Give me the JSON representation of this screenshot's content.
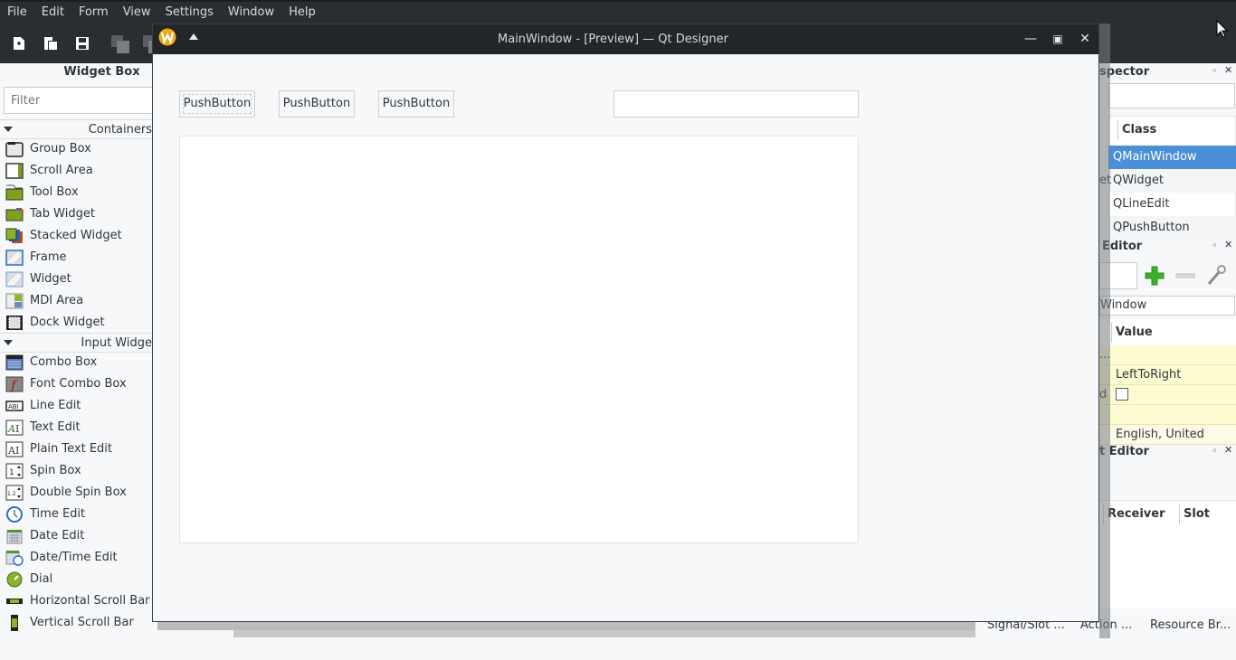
{
  "menubar": {
    "items": [
      "File",
      "Edit",
      "Form",
      "View",
      "Settings",
      "Window",
      "Help"
    ]
  },
  "toolbar": {
    "icons": [
      "new-form-icon",
      "open-form-icon",
      "save-form-icon",
      "cascade-windows-icon",
      "tile-windows-icon"
    ]
  },
  "widget_box": {
    "title": "Widget Box",
    "filter_placeholder": "Filter",
    "categories": [
      {
        "label": "Containers",
        "items": [
          "Group Box",
          "Scroll Area",
          "Tool Box",
          "Tab Widget",
          "Stacked Widget",
          "Frame",
          "Widget",
          "MDI Area",
          "Dock Widget"
        ]
      },
      {
        "label": "Input Widge",
        "items": [
          "Combo Box",
          "Font Combo Box",
          "Line Edit",
          "Text Edit",
          "Plain Text Edit",
          "Spin Box",
          "Double Spin Box",
          "Time Edit",
          "Date Edit",
          "Date/Time Edit",
          "Dial",
          "Horizontal Scroll Bar",
          "Vertical Scroll Bar"
        ]
      }
    ]
  },
  "preview_window": {
    "title": "MainWindow - [Preview] — Qt Designer",
    "buttons": [
      "PushButton",
      "PushButton",
      "PushButton"
    ],
    "line_edit_value": ""
  },
  "object_inspector": {
    "title": "spector",
    "class_header": "Class",
    "rows": [
      {
        "object": "",
        "class": "QMainWindow",
        "selected": true
      },
      {
        "object": "et",
        "class": "QWidget",
        "selected": false
      },
      {
        "object": "",
        "class": "QLineEdit",
        "selected": false
      },
      {
        "object": "",
        "class": "QPushButton",
        "selected": false
      }
    ]
  },
  "property_editor": {
    "title": "Editor",
    "object_label": "Window",
    "value_header": "Value",
    "rows": [
      {
        "name": "...",
        "value": ""
      },
      {
        "name": "",
        "value": "LeftToRight"
      },
      {
        "name": "d",
        "value": "",
        "checkbox": true
      },
      {
        "name": "",
        "value": ""
      },
      {
        "name": "",
        "value": "English, United Sta..."
      }
    ]
  },
  "signal_slot_editor": {
    "title": "t Editor",
    "headers": [
      "Receiver",
      "Slot"
    ]
  },
  "bottom_tabs": [
    "Signal/Slot ...",
    "Action ...",
    "Resource Br..."
  ],
  "colors": {
    "selection": "#3daee9",
    "selected_row": "#4a90d9",
    "property_bg": "#fdfbd0",
    "titlebar": "#232629"
  }
}
